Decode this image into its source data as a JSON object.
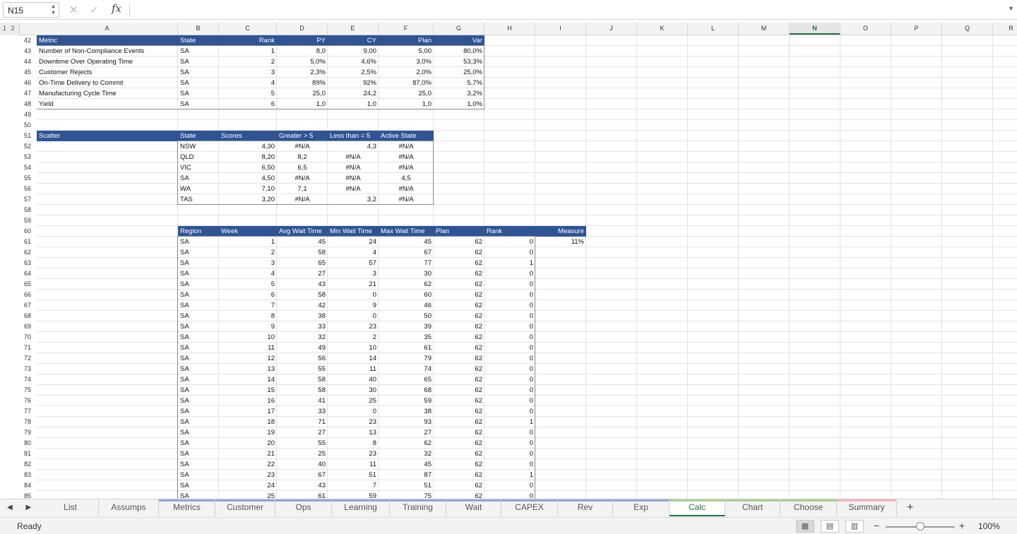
{
  "formula_bar": {
    "name_box": "N15",
    "formula": "",
    "cancel_icon": "✕",
    "enter_icon": "✓",
    "fx_label": "fx",
    "expand_icon": "▾",
    "namebox_arrows": "▲▼"
  },
  "group_tabs": "1 2",
  "columns": [
    "A",
    "B",
    "C",
    "D",
    "E",
    "F",
    "G",
    "H",
    "I",
    "J",
    "K",
    "L",
    "M",
    "N",
    "O",
    "P",
    "Q",
    "R"
  ],
  "selected_column": "N",
  "rows": [
    42,
    43,
    44,
    45,
    46,
    47,
    48,
    49,
    50,
    51,
    52,
    53,
    54,
    55,
    56,
    57,
    58,
    59,
    60,
    61,
    62,
    63,
    64,
    65,
    66,
    67,
    68,
    69,
    70,
    71,
    72,
    73,
    74,
    75,
    76,
    77,
    78,
    79,
    80,
    81,
    82,
    83,
    84,
    85
  ],
  "metrics_table": {
    "headers": [
      "Metric",
      "State",
      "Rank",
      "PY",
      "CY",
      "Plan",
      "Var"
    ],
    "rows": [
      [
        "Number of Non-Compliance Events",
        "SA",
        "1",
        "8,0",
        "9,00",
        "5,00",
        "80,0%"
      ],
      [
        "Downtime Over Operating Time",
        "SA",
        "2",
        "5,0%",
        "4,6%",
        "3,0%",
        "53,3%"
      ],
      [
        "Customer Rejects",
        "SA",
        "3",
        "2,3%",
        "2,5%",
        "2,0%",
        "25,0%"
      ],
      [
        "On-Time Delivery to Commit",
        "SA",
        "4",
        "89%",
        "92%",
        "87,0%",
        "5,7%"
      ],
      [
        "Manufacturing Cycle Time",
        "SA",
        "5",
        "25,0",
        "24,2",
        "25,0",
        "3,2%"
      ],
      [
        "Yield",
        "SA",
        "6",
        "1,0",
        "1,0",
        "1,0",
        "1,0%"
      ]
    ]
  },
  "scatter_table": {
    "headers": [
      "Scatter",
      "State",
      "Scores",
      "Greater > 5",
      "Less than = 5",
      "Active State"
    ],
    "rows": [
      [
        "NSW",
        "4,30",
        "#N/A",
        "4,3",
        "#N/A"
      ],
      [
        "QLD",
        "8,20",
        "8,2",
        "#N/A",
        "#N/A"
      ],
      [
        "VIC",
        "6,50",
        "6,5",
        "#N/A",
        "#N/A"
      ],
      [
        "SA",
        "4,50",
        "#N/A",
        "#N/A",
        "4,5"
      ],
      [
        "WA",
        "7,10",
        "7,1",
        "#N/A",
        "#N/A"
      ],
      [
        "TAS",
        "3,20",
        "#N/A",
        "3,2",
        "#N/A"
      ]
    ]
  },
  "wait_table": {
    "headers": [
      "Region",
      "Week",
      "Avg Wait Time",
      "Min Wait Time",
      "Max Wait Time",
      "Plan",
      "Rank",
      "Measure"
    ],
    "measure_value": "11%",
    "rows": [
      [
        "SA",
        "1",
        "45",
        "24",
        "45",
        "62",
        "0"
      ],
      [
        "SA",
        "2",
        "58",
        "4",
        "67",
        "62",
        "0"
      ],
      [
        "SA",
        "3",
        "65",
        "57",
        "77",
        "62",
        "1"
      ],
      [
        "SA",
        "4",
        "27",
        "3",
        "30",
        "62",
        "0"
      ],
      [
        "SA",
        "5",
        "43",
        "21",
        "62",
        "62",
        "0"
      ],
      [
        "SA",
        "6",
        "58",
        "0",
        "60",
        "62",
        "0"
      ],
      [
        "SA",
        "7",
        "42",
        "9",
        "46",
        "62",
        "0"
      ],
      [
        "SA",
        "8",
        "38",
        "0",
        "50",
        "62",
        "0"
      ],
      [
        "SA",
        "9",
        "33",
        "23",
        "39",
        "62",
        "0"
      ],
      [
        "SA",
        "10",
        "32",
        "2",
        "35",
        "62",
        "0"
      ],
      [
        "SA",
        "11",
        "49",
        "10",
        "61",
        "62",
        "0"
      ],
      [
        "SA",
        "12",
        "56",
        "14",
        "79",
        "62",
        "0"
      ],
      [
        "SA",
        "13",
        "55",
        "11",
        "74",
        "62",
        "0"
      ],
      [
        "SA",
        "14",
        "58",
        "40",
        "65",
        "62",
        "0"
      ],
      [
        "SA",
        "15",
        "58",
        "30",
        "68",
        "62",
        "0"
      ],
      [
        "SA",
        "16",
        "41",
        "25",
        "59",
        "62",
        "0"
      ],
      [
        "SA",
        "17",
        "33",
        "0",
        "38",
        "62",
        "0"
      ],
      [
        "SA",
        "18",
        "71",
        "23",
        "93",
        "62",
        "1"
      ],
      [
        "SA",
        "19",
        "27",
        "13",
        "27",
        "62",
        "0"
      ],
      [
        "SA",
        "20",
        "55",
        "8",
        "62",
        "62",
        "0"
      ],
      [
        "SA",
        "21",
        "25",
        "23",
        "32",
        "62",
        "0"
      ],
      [
        "SA",
        "22",
        "40",
        "11",
        "45",
        "62",
        "0"
      ],
      [
        "SA",
        "23",
        "67",
        "51",
        "87",
        "62",
        "1"
      ],
      [
        "SA",
        "24",
        "43",
        "7",
        "51",
        "62",
        "0"
      ],
      [
        "SA",
        "25",
        "61",
        "59",
        "75",
        "62",
        "0"
      ]
    ]
  },
  "sheet_tabs": [
    {
      "label": "List",
      "color": ""
    },
    {
      "label": "Assumps",
      "color": ""
    },
    {
      "label": "Metrics",
      "color": "#8ea9db"
    },
    {
      "label": "Customer",
      "color": "#8ea9db"
    },
    {
      "label": "Ops",
      "color": "#8ea9db"
    },
    {
      "label": "Learning",
      "color": "#8ea9db"
    },
    {
      "label": "Training",
      "color": "#8ea9db"
    },
    {
      "label": "Wait",
      "color": "#8ea9db"
    },
    {
      "label": "CAPEX",
      "color": "#8ea9db"
    },
    {
      "label": "Rev",
      "color": "#8ea9db"
    },
    {
      "label": "Exp",
      "color": "#8ea9db"
    },
    {
      "label": "Calc",
      "color": "#a9d08e"
    },
    {
      "label": "Chart",
      "color": "#a9d08e"
    },
    {
      "label": "Choose",
      "color": "#a9d08e"
    },
    {
      "label": "Summary",
      "color": "#f4b6b6"
    }
  ],
  "active_tab": "Calc",
  "tab_nav_icons": "◀ ▶",
  "add_sheet_icon": "+",
  "status": {
    "text": "Ready",
    "zoom": "100%",
    "zoom_fraction": 0.5,
    "view_icons": [
      "▦",
      "▤",
      "▥"
    ],
    "zoom_minus": "−",
    "zoom_plus": "+"
  },
  "colors": {
    "header_fill": "#2f5496",
    "accent": "#1e7145"
  }
}
